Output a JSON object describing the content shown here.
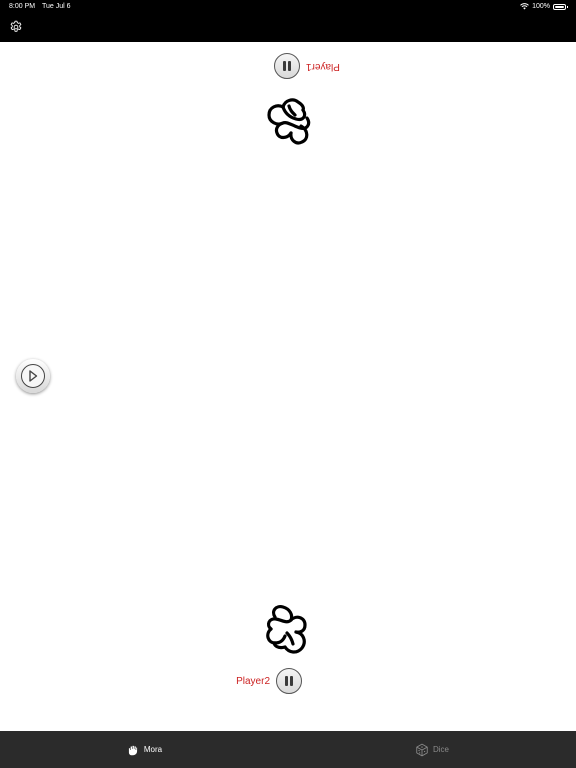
{
  "status_bar": {
    "time": "8:00 PM",
    "date": "Tue Jul 6",
    "battery": "100%"
  },
  "icons": {
    "settings": "gear-icon",
    "wifi": "wifi-icon",
    "battery": "battery-icon",
    "pause": "pause-icon",
    "play": "play-icon",
    "hand": "hand-gesture-icon",
    "mora_tab": "fist-icon",
    "dice_tab": "dice-icon"
  },
  "players": [
    {
      "name": "Player1"
    },
    {
      "name": "Player2"
    }
  ],
  "tabs": [
    {
      "label": "Mora",
      "selected": true
    },
    {
      "label": "Dice",
      "selected": false
    }
  ],
  "colors": {
    "player_name": "#cc2222",
    "bars": "#000000",
    "tab_bar": "#2b2b2b",
    "tab_active": "#ffffff",
    "tab_inactive": "#8a8a8a"
  }
}
